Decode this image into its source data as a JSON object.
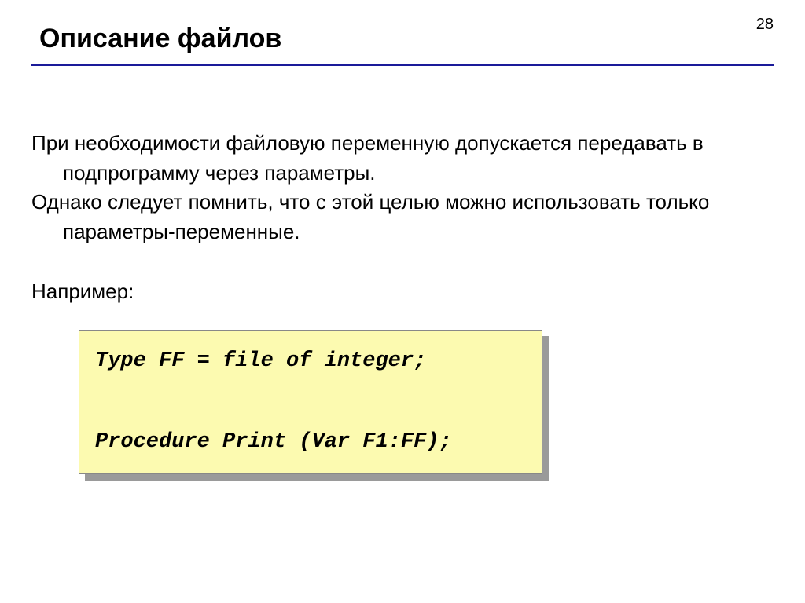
{
  "page_number": "28",
  "title": "Описание файлов",
  "paragraph1": "При необходимости файловую переменную допускается передавать в подпрограмму через параметры.",
  "paragraph2": "Однако следует помнить, что с этой целью можно использовать только параметры-переменные.",
  "example_label": "Например:",
  "code": "Type FF = file of integer;\n\nProcedure Print (Var F1:FF);"
}
